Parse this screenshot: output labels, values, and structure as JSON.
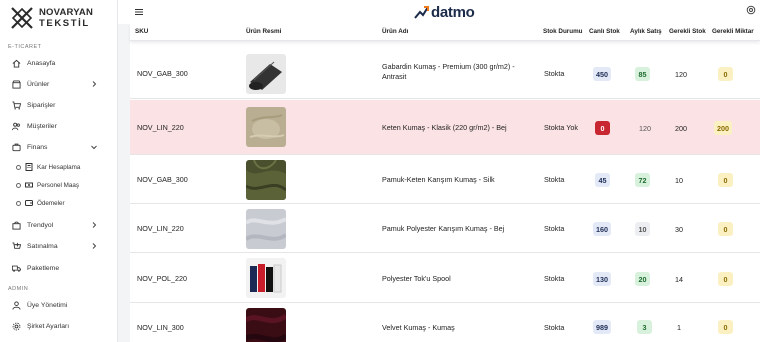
{
  "brand": {
    "line1": "NOVARYAN",
    "line2": "TEKSTİL"
  },
  "sidebar": {
    "section_eticaret": "E-TICARET",
    "section_admin": "ADMIN",
    "items": [
      {
        "label": "Anasayfa",
        "icon": "home-icon"
      },
      {
        "label": "Ürünler",
        "icon": "store-icon",
        "chevron": "chevron-right-icon"
      },
      {
        "label": "Siparişler",
        "icon": "cart-icon"
      },
      {
        "label": "Müşteriler",
        "icon": "users-icon"
      },
      {
        "label": "Finans",
        "icon": "finance-icon",
        "chevron": "chevron-down-icon"
      }
    ],
    "finans_sub": [
      {
        "label": "Kar Hesaplama",
        "icon": "calculator-icon"
      },
      {
        "label": "Personel Maaş",
        "icon": "money-icon"
      },
      {
        "label": "Ödemeler",
        "icon": "wallet-icon"
      }
    ],
    "items2": [
      {
        "label": "Trendyol",
        "icon": "trendyol-icon",
        "chevron": "chevron-right-icon"
      },
      {
        "label": "Satınalma",
        "icon": "purchase-cart-icon",
        "chevron": "chevron-right-icon"
      },
      {
        "label": "Paketleme",
        "icon": "truck-icon"
      }
    ],
    "admin_items": [
      {
        "label": "Üye Yönetimi",
        "icon": "member-icon"
      },
      {
        "label": "Şirket Ayarları",
        "icon": "settings-icon"
      }
    ]
  },
  "topbar": {
    "logo_text": "datmo"
  },
  "table": {
    "headers": [
      "SKU",
      "Ürün Resmi",
      "Ürün Adı",
      "Stok Durumu",
      "Canlı Stok",
      "Aylık Satış",
      "Gerekli Stok",
      "Gerekli Miktar"
    ],
    "rows": [
      {
        "sku": "NOV_GAB_300",
        "name": "Gabardin Kumaş - Premium (300 gr/m2) - Antrasit",
        "status": "Stokta",
        "live": "450",
        "monthly": "85",
        "required": "120",
        "qty": "0",
        "alert": false
      },
      {
        "sku": "NOV_LIN_220",
        "name": "Keten Kumaş - Klasik (220 gr/m2) - Bej",
        "status": "Stokta Yok",
        "live": "0",
        "monthly": "120",
        "required": "200",
        "qty": "200",
        "alert": true
      },
      {
        "sku": "NOV_GAB_300",
        "name": "Pamuk-Keten Karışım Kumaş - Silk",
        "status": "Stokta",
        "live": "45",
        "monthly": "72",
        "required": "10",
        "qty": "0",
        "alert": false
      },
      {
        "sku": "NOV_LIN_220",
        "name": "Pamuk Polyester Karışım Kumaş - Bej",
        "status": "Stokta",
        "live": "160",
        "monthly": "10",
        "required": "30",
        "qty": "0",
        "alert": false
      },
      {
        "sku": "NOV_POL_220",
        "name": "Polyester Tok'u Spool",
        "status": "Stokta",
        "live": "130",
        "monthly": "20",
        "required": "14",
        "qty": "0",
        "alert": false
      },
      {
        "sku": "NOV_LIN_300",
        "name": "Velvet Kumaş - Kumaş",
        "status": "Stokta",
        "live": "989",
        "monthly": "3",
        "required": "1",
        "qty": "0",
        "alert": false
      }
    ]
  },
  "colors": {
    "badge_blue_bg": "#e3e9f7",
    "badge_blue_fg": "#1d2d55",
    "badge_green_bg": "#d7f1dc",
    "badge_green_fg": "#1f6b2e",
    "badge_gray_bg": "#eceef1",
    "badge_gray_fg": "#555555",
    "badge_red_bg": "#c82630",
    "badge_red_fg": "#ffffff",
    "badge_yellow_bg": "#fbf0c2",
    "badge_yellow_fg": "#8a6a00",
    "alert_row_bg": "#fbe2e4"
  }
}
